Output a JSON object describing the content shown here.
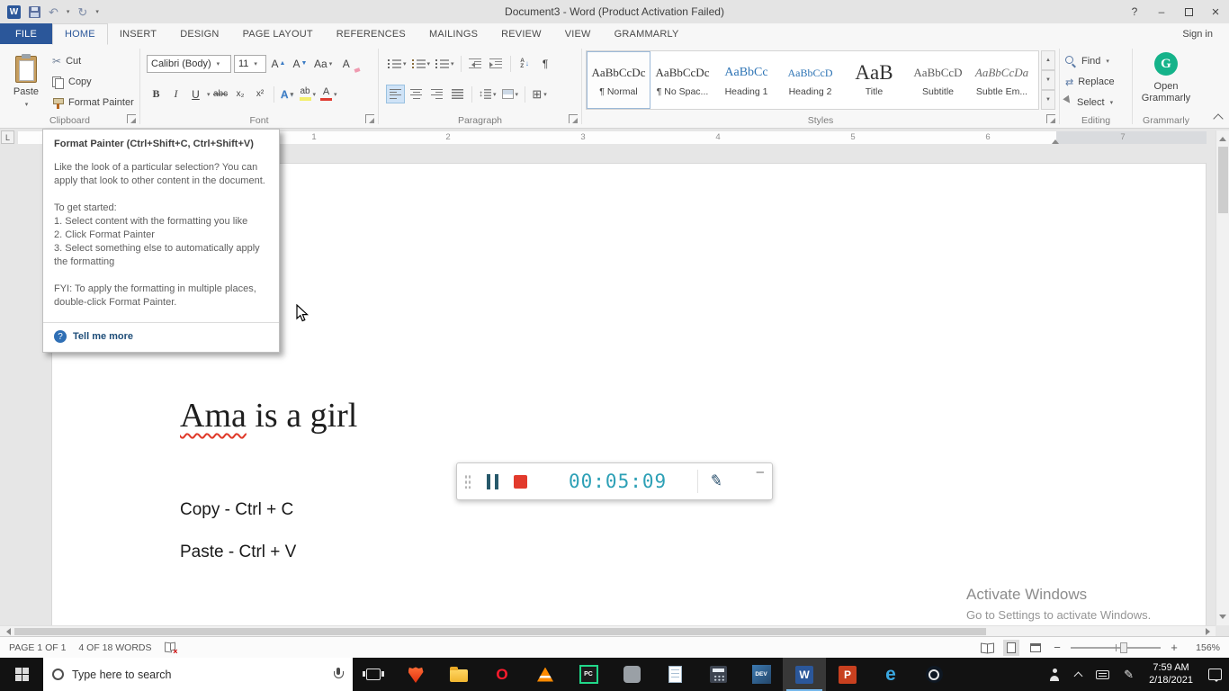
{
  "icons": {
    "caret": "▾",
    "scissors": "✂",
    "pilcrow": "¶",
    "undo": "↶",
    "redo": "↻",
    "help": "?",
    "minimize": "–",
    "updown": "↕",
    "down_arrow": "↓",
    "borders": "⊞",
    "replace_arrows": "⇄",
    "pen": "✎",
    "question": "?",
    "ruler_tab": "L",
    "gallery_up": "▲",
    "gallery_down": "▼",
    "opera": "O",
    "edge": "e",
    "word": "W",
    "powerpoint": "P",
    "pycharm": "PC",
    "dev": "DEV"
  },
  "titlebar": {
    "title": "Document3 - Word (Product Activation Failed)"
  },
  "tabs": {
    "file": "FILE",
    "items": [
      "HOME",
      "INSERT",
      "DESIGN",
      "PAGE LAYOUT",
      "REFERENCES",
      "MAILINGS",
      "REVIEW",
      "VIEW",
      "GRAMMARLY"
    ],
    "sign_in": "Sign in"
  },
  "ribbon": {
    "clipboard": {
      "label": "Clipboard",
      "paste": "Paste",
      "cut": "Cut",
      "copy": "Copy",
      "format_painter": "Format Painter"
    },
    "font": {
      "label": "Font",
      "family": "Calibri (Body)",
      "size": "11",
      "bold": "B",
      "italic": "I",
      "underline": "U",
      "strikethrough": "abc",
      "subscript": "x₂",
      "superscript": "x²",
      "change_case": "Aa",
      "grow": "A",
      "shrink": "A",
      "effects": "A",
      "highlight": "ab",
      "font_color": "A"
    },
    "paragraph": {
      "label": "Paragraph",
      "sort_a": "A",
      "sort_z": "Z"
    },
    "styles": {
      "label": "Styles",
      "items": [
        {
          "preview": "AaBbCcDc",
          "name": "¶ Normal"
        },
        {
          "preview": "AaBbCcDc",
          "name": "¶ No Spac..."
        },
        {
          "preview": "AaBbCc",
          "name": "Heading 1"
        },
        {
          "preview": "AaBbCcD",
          "name": "Heading 2"
        },
        {
          "preview": "AaB",
          "name": "Title"
        },
        {
          "preview": "AaBbCcD",
          "name": "Subtitle"
        },
        {
          "preview": "AaBbCcDa",
          "name": "Subtle Em..."
        }
      ]
    },
    "editing": {
      "label": "Editing",
      "find": "Find",
      "replace": "Replace",
      "select": "Select"
    },
    "grammarly": {
      "label": "Grammarly",
      "open": "Open Grammarly",
      "logo": "G"
    }
  },
  "tooltip": {
    "title": "Format Painter (Ctrl+Shift+C, Ctrl+Shift+V)",
    "body1": "Like the look of a particular selection? You can apply that look to other content in the document.",
    "get_started": "To get started:",
    "step1": "1. Select content with the formatting you like",
    "step2": "2. Click Format Painter",
    "step3": "3. Select something else to automatically apply the formatting",
    "fyi": "FYI: To apply the formatting in multiple places, double-click Format Painter.",
    "link": "Tell me more"
  },
  "ruler": {
    "marks": [
      "1",
      "2",
      "3",
      "4",
      "5",
      "6",
      "7"
    ]
  },
  "document": {
    "heading_word": "Ama",
    "heading_rest": " is a girl",
    "copy_line": "Copy - Ctrl + C",
    "paste_line": "Paste - Ctrl + V"
  },
  "recorder": {
    "time": "00:05:09"
  },
  "watermark": {
    "line1": "Activate Windows",
    "line2": "Go to Settings to activate Windows."
  },
  "statusbar": {
    "page": "PAGE 1 OF 1",
    "words": "4 OF 18 WORDS",
    "zoom": "156%"
  },
  "taskbar": {
    "search_placeholder": "Type here to search",
    "time": "7:59 AM",
    "date": "2/18/2021"
  }
}
